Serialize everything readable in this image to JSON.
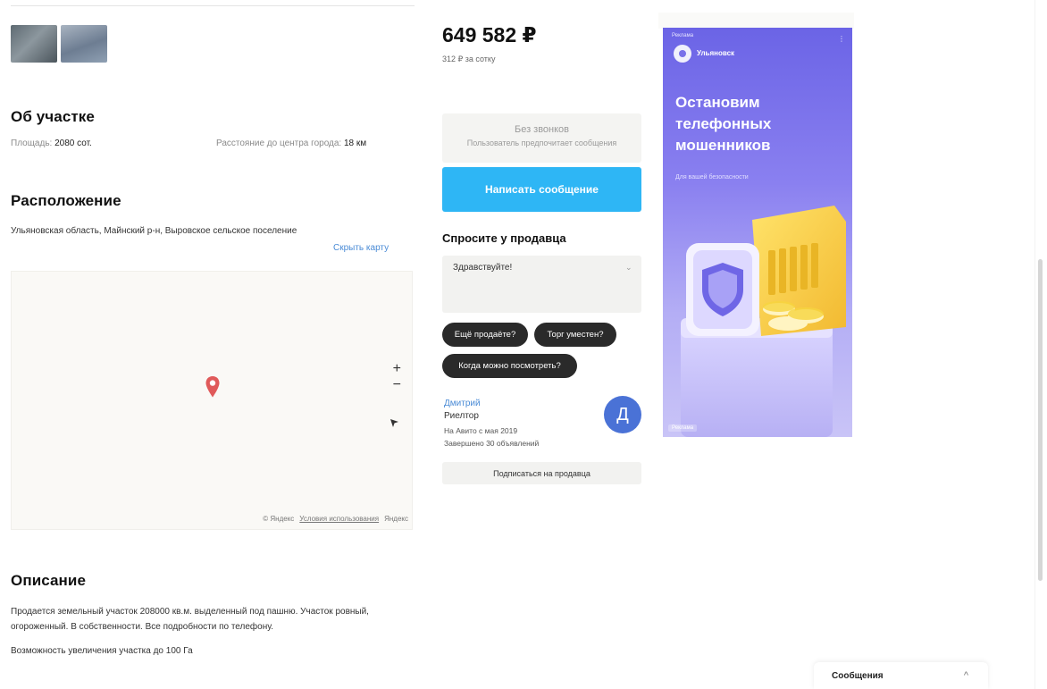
{
  "gallery": {
    "thumbnails": [
      "thumbnail-1",
      "thumbnail-2"
    ]
  },
  "about": {
    "title": "Об участке",
    "area_label": "Площадь:",
    "area_value": "2080 сот.",
    "distance_label": "Расстояние до центра города:",
    "distance_value": "18 км"
  },
  "location": {
    "title": "Расположение",
    "address": "Ульяновская область, Майнский р-н, Выровское сельское поселение",
    "hide_map": "Скрыть карту",
    "map_footer_brand": "© Яндекс",
    "map_footer_terms": "Условия использования",
    "map_footer_maps": "Яндекс",
    "zoom_in": "+",
    "zoom_out": "−",
    "icons": {
      "pin": "map-pin-icon",
      "locate": "locate-arrow-icon"
    }
  },
  "description": {
    "title": "Описание",
    "text_1": "Продается земельный участок 208000 кв.м. выделенный под пашню. Участок ровный, огороженный. В собственности. Все подробности по телефону.",
    "text_2": "Возможность увеличения участка до 100 Га"
  },
  "pricing": {
    "price": "649 582 ₽",
    "price_sub": "312 ₽ за сотку"
  },
  "contact": {
    "call_line_1": "Без звонков",
    "call_line_2": "Пользователь предпочитает сообщения",
    "write_button": "Написать сообщение"
  },
  "ask": {
    "title": "Спросите у продавца",
    "input_value": "Здравствуйте!",
    "chips": [
      "Ещё продаёте?",
      "Торг уместен?",
      "Когда можно посмотреть?"
    ]
  },
  "seller": {
    "name": "Дмитрий",
    "role": "Риелтор",
    "since": "На Авито с мая 2019",
    "completed": "Завершено 30 объявлений",
    "avatar_letter": "Д",
    "subscribe_button": "Подписаться на продавца"
  },
  "ad": {
    "top_label": "Реклама",
    "brand": "Ульяновск",
    "headline": "Остановим телефонных мошенников",
    "subtext": "Для вашей безопасности",
    "tag": "Реклама",
    "menu": "⋮",
    "colors": {
      "bg_top": "#6b64e6",
      "bg_bottom": "#c9c4f7",
      "accent_yellow": "#f7d53f"
    }
  },
  "messages_bar": {
    "label": "Сообщения",
    "chevron": "^"
  },
  "colors": {
    "link": "#4a8bd6",
    "primary_button": "#2eb6f5",
    "chip": "#2a2a2a",
    "avatar": "#4a72d6",
    "map_pin": "#e05a5a"
  }
}
